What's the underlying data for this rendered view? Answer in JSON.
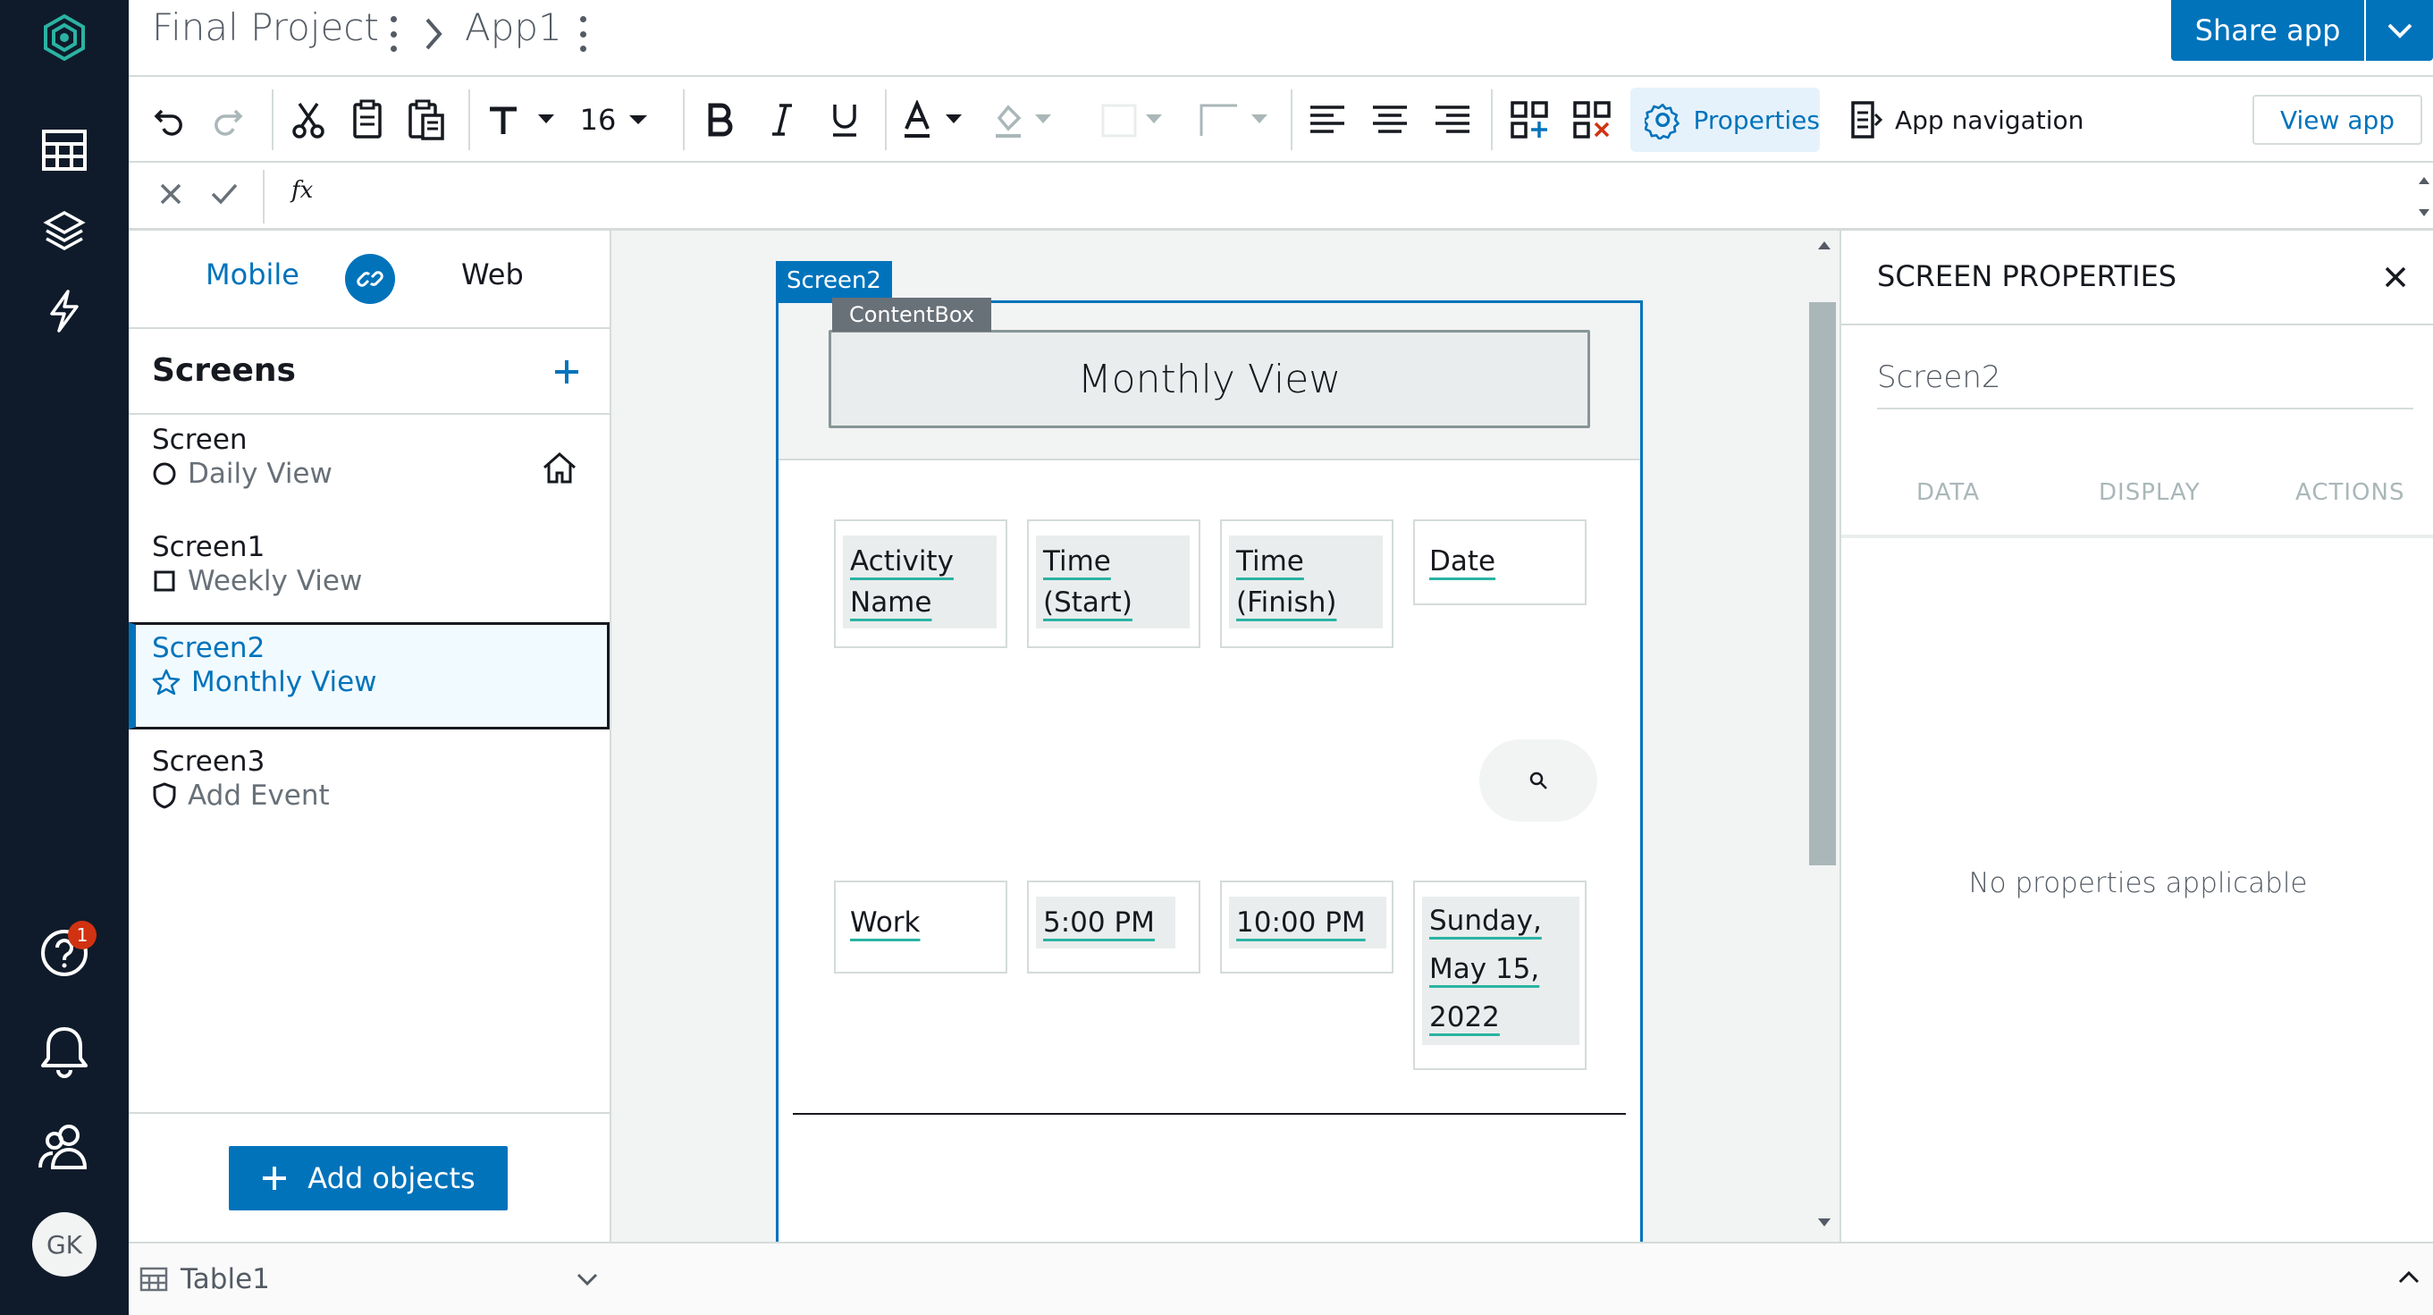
{
  "titlebar": {
    "project": "Final Project",
    "app": "App1",
    "share_label": "Share app"
  },
  "toolbar": {
    "font_size": "16",
    "properties_label": "Properties",
    "app_navigation_label": "App navigation",
    "view_app_label": "View app"
  },
  "formula": {
    "fx": "fx",
    "value": ""
  },
  "left_panel": {
    "mobile_label": "Mobile",
    "web_label": "Web",
    "screens_title": "Screens",
    "screens": [
      {
        "name": "Screen",
        "subtitle": "Daily View",
        "icon": "circle-icon",
        "home": true
      },
      {
        "name": "Screen1",
        "subtitle": "Weekly View",
        "icon": "square-icon",
        "home": false
      },
      {
        "name": "Screen2",
        "subtitle": "Monthly View",
        "icon": "star-icon",
        "home": false,
        "selected": true
      },
      {
        "name": "Screen3",
        "subtitle": "Add Event",
        "icon": "shield-icon",
        "home": false
      }
    ],
    "add_objects_label": "Add objects"
  },
  "canvas": {
    "screen_tag": "Screen2",
    "contentbox_tag": "ContentBox",
    "title": "Monthly View",
    "headers": [
      "Activity Name",
      "Time (Start)",
      "Time (Finish)",
      "Date"
    ],
    "header_lines": [
      [
        "Activity",
        "Name"
      ],
      [
        "Time",
        "(Start)"
      ],
      [
        "Time",
        "(Finish)"
      ],
      [
        "Date"
      ]
    ],
    "row": [
      "Work",
      "5:00 PM",
      "10:00 PM",
      "Sunday, May 15, 2022"
    ],
    "row_lines": [
      [
        "Work"
      ],
      [
        "5:00 PM"
      ],
      [
        "10:00 PM"
      ],
      [
        "Sunday,",
        "May 15,",
        "2022"
      ]
    ]
  },
  "properties": {
    "title": "SCREEN PROPERTIES",
    "screen_name": "Screen2",
    "tabs": [
      "DATA",
      "DISPLAY",
      "ACTIONS"
    ],
    "empty_message": "No properties applicable"
  },
  "bottom": {
    "table_label": "Table1"
  },
  "rail": {
    "avatar_initials": "GK",
    "help_badge": "1"
  },
  "colors": {
    "rail_bg": "#0f1b2a",
    "accent": "#0073bb",
    "badge": "#d13212",
    "underline": "#2bb3a3"
  }
}
